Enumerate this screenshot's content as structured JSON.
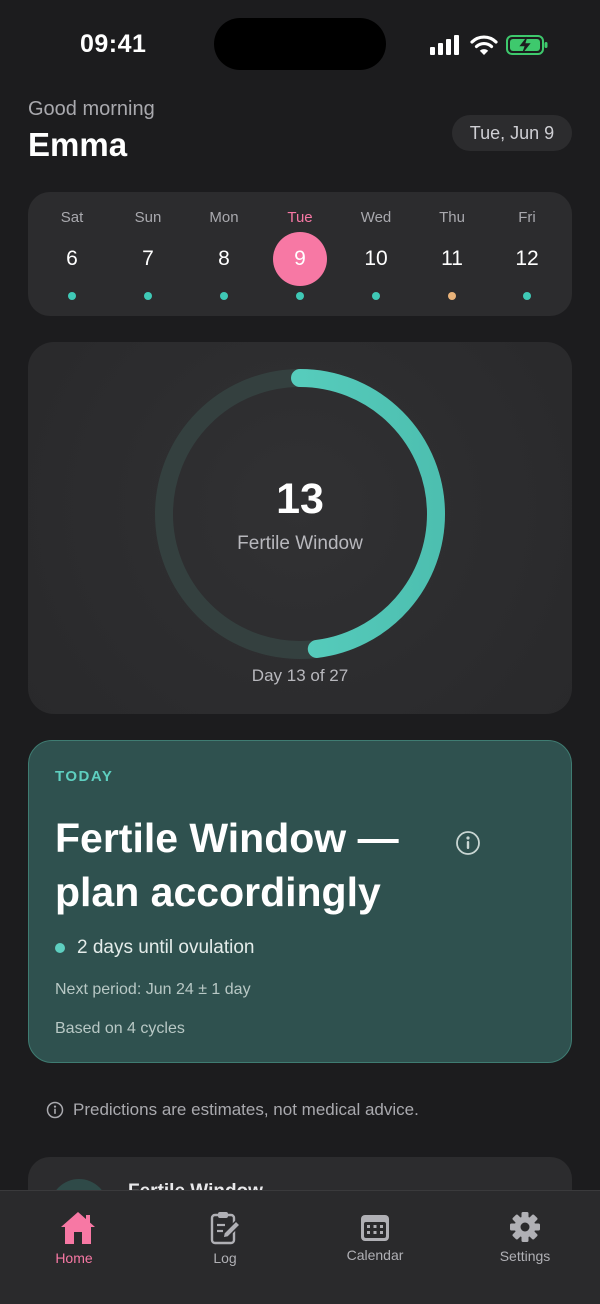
{
  "status_bar": {
    "time": "09:41"
  },
  "header": {
    "greeting": "Good morning",
    "name": "Emma",
    "date_chip": "Tue, Jun 9"
  },
  "week": {
    "days": [
      {
        "name": "Sat",
        "num": "6",
        "dot": "#3fc9b6"
      },
      {
        "name": "Sun",
        "num": "7",
        "dot": "#3fc9b6"
      },
      {
        "name": "Mon",
        "num": "8",
        "dot": "#3fc9b6"
      },
      {
        "name": "Tue",
        "num": "9",
        "dot": "#3fc9b6",
        "selected": true
      },
      {
        "name": "Wed",
        "num": "10",
        "dot": "#3fc9b6"
      },
      {
        "name": "Thu",
        "num": "11",
        "dot": "#e9b37a"
      },
      {
        "name": "Fri",
        "num": "12",
        "dot": "#3fc9b6"
      }
    ]
  },
  "cycle": {
    "day_number": "13",
    "phase_label": "Fertile Window",
    "caption": "Day 13 of 27",
    "progress": 0.48
  },
  "today": {
    "tag": "TODAY",
    "title": "Fertile Window — plan accordingly",
    "ovulation": "2 days until ovulation",
    "next_period": "Next period: Jun 24 ± 1 day",
    "based_on": "Based on 4 cycles"
  },
  "disclaimer": "Predictions are estimates, not medical advice.",
  "peek_card": {
    "title": "Fertile Window"
  },
  "tabs": [
    {
      "label": "Home",
      "icon": "home-icon",
      "active": true
    },
    {
      "label": "Log",
      "icon": "clipboard-edit-icon"
    },
    {
      "label": "Calendar",
      "icon": "calendar-icon"
    },
    {
      "label": "Settings",
      "icon": "gear-icon"
    }
  ],
  "colors": {
    "accent_pink": "#f778a4",
    "accent_teal": "#5ecfc0",
    "background": "#1c1c1e",
    "card": "#2c2c2e",
    "today_card": "#2f514f"
  }
}
